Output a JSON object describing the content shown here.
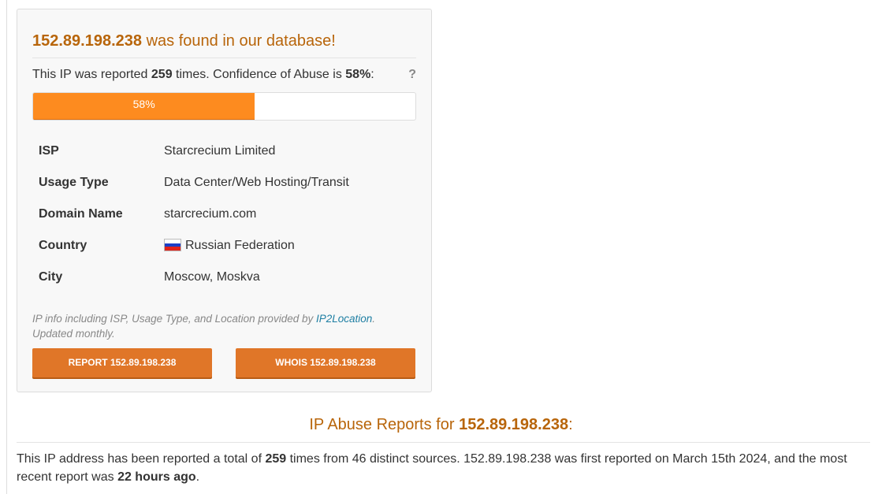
{
  "header": {
    "ip": "152.89.198.238",
    "found_text": " was found in our database!"
  },
  "abuse": {
    "prefix": "This IP was reported ",
    "count": "259",
    "middle": " times. Confidence of Abuse is ",
    "confidence": "58%",
    "suffix": ":",
    "help": "?",
    "bar_label": "58%",
    "bar_fraction": 0.58
  },
  "info": {
    "isp_label": "ISP",
    "isp": "Starcrecium Limited",
    "usage_label": "Usage Type",
    "usage": "Data Center/Web Hosting/Transit",
    "domain_label": "Domain Name",
    "domain": "starcrecium.com",
    "country_label": "Country",
    "country": "Russian Federation",
    "country_flag_icon": "russia-flag-icon",
    "city_label": "City",
    "city": "Moscow, Moskva"
  },
  "note": {
    "text": "IP info including ISP, Usage Type, and Location provided by ",
    "link": "IP2Location",
    "after": ". Updated monthly."
  },
  "buttons": {
    "report": "REPORT 152.89.198.238",
    "whois": "WHOIS 152.89.198.238"
  },
  "reports": {
    "title_prefix": "IP Abuse Reports for ",
    "title_ip": "152.89.198.238",
    "title_suffix": ":",
    "s1": "This IP address has been reported a total of ",
    "s_count": "259",
    "s2": " times from 46 distinct sources. 152.89.198.238 was first reported on March 15th 2024, and the most recent report was ",
    "s_recent": "22 hours ago",
    "s3": "."
  },
  "colors": {
    "accent": "#b8650a",
    "bar": "#fd8b1f",
    "button": "#e07628",
    "link": "#1f7fa3"
  }
}
